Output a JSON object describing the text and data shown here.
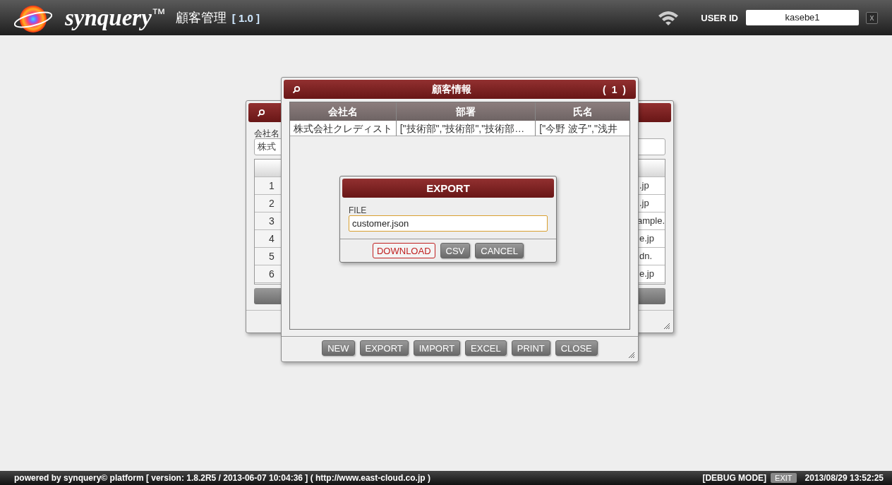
{
  "header": {
    "brand": "synquery",
    "trademark": "™",
    "app_title": "顧客管理",
    "version": "[ 1.0 ]",
    "user_id_label": "USER ID",
    "user_id": "kasebe1",
    "close_button": "x"
  },
  "back_window": {
    "company_label": "会社名",
    "company_value": "株式",
    "rows": [
      {
        "number": "1",
        "email": ".jp"
      },
      {
        "number": "2",
        "email": ".jp"
      },
      {
        "number": "3",
        "email": "ample."
      },
      {
        "number": "4",
        "email": "e.jp"
      },
      {
        "number": "5",
        "email": "dn."
      },
      {
        "number": "6",
        "email": "e.jp"
      }
    ]
  },
  "list_window": {
    "title": "顧客情報",
    "count": "( 1 )",
    "columns": [
      "会社名",
      "部署",
      "氏名"
    ],
    "rows": [
      [
        "株式会社クレディスト",
        "[\"技術部\",\"技術部\",\"技術部…",
        "[\"今野 波子\",\"浅井"
      ]
    ],
    "buttons": [
      "NEW",
      "EXPORT",
      "IMPORT",
      "EXCEL",
      "PRINT",
      "CLOSE"
    ]
  },
  "export_dialog": {
    "title": "EXPORT",
    "file_label": "FILE",
    "file_value": "customer.json",
    "buttons": [
      {
        "label": "DOWNLOAD",
        "kind": "primary"
      },
      {
        "label": "CSV",
        "kind": "default"
      },
      {
        "label": "CANCEL",
        "kind": "default"
      }
    ]
  },
  "status_bar": {
    "powered_by": "powered by synquery© platform [ version: 1.8.2R5 / 2013-06-07 10:04:36 ] ( http://www.east-cloud.co.jp )",
    "mode": "[DEBUG MODE]",
    "exit_button": "EXIT",
    "timestamp": "2013/08/29 13:52:25"
  }
}
